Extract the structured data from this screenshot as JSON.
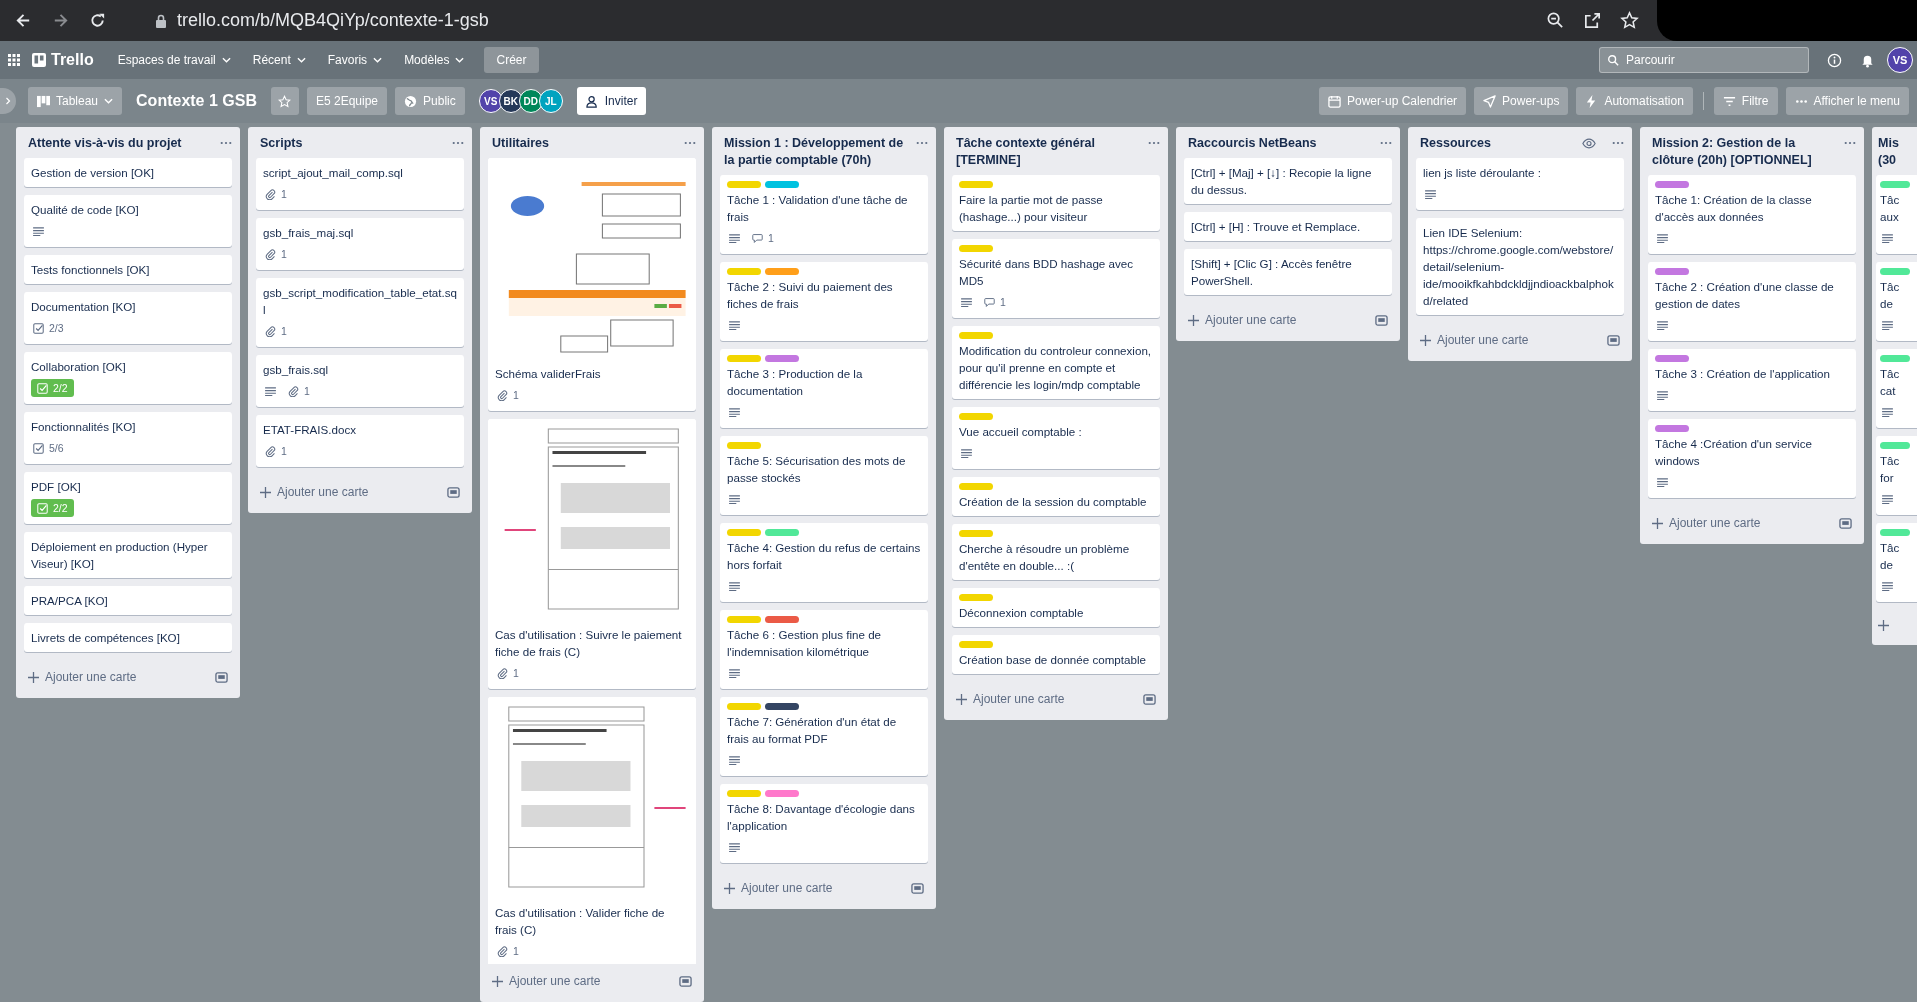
{
  "browser": {
    "url": "trello.com/b/MQB4QiYp/contexte-1-gsb"
  },
  "nav": {
    "logo": "Trello",
    "menus": [
      "Espaces de travail",
      "Récent",
      "Favoris",
      "Modèles"
    ],
    "create": "Créer",
    "search": {
      "placeholder": "Parcourir"
    },
    "avatar": {
      "initials": "VS",
      "color": "#5243aa"
    }
  },
  "board_header": {
    "view": "Tableau",
    "title": "Contexte 1 GSB",
    "starred": false,
    "workspace": "E5 2Equipe",
    "visibility": "Public",
    "members": [
      {
        "initials": "VS",
        "color": "#5243aa"
      },
      {
        "initials": "BK",
        "color": "#253858"
      },
      {
        "initials": "DD",
        "color": "#00875a"
      },
      {
        "initials": "JL",
        "color": "#00a3bf"
      }
    ],
    "invite": "Inviter",
    "actions": [
      {
        "kind": "calendar",
        "label": "Power-up Calendrier"
      },
      {
        "kind": "power-ups",
        "label": "Power-ups"
      },
      {
        "kind": "automation",
        "label": "Automatisation"
      },
      {
        "kind": "filter",
        "label": "Filtre"
      },
      {
        "kind": "menu",
        "label": "Afficher le menu"
      }
    ]
  },
  "lists": [
    {
      "title": "Attente vis-à-vis du projet",
      "watched": false,
      "cut_off": false,
      "add_label": "Ajouter une carte",
      "cards": [
        {
          "title": "Gestion de version [OK]"
        },
        {
          "title": "Qualité de code [KO]",
          "badges": [
            {
              "kind": "description"
            }
          ]
        },
        {
          "title": "Tests fonctionnels [OK]"
        },
        {
          "title": "Documentation [KO]",
          "badges": [
            {
              "kind": "checklist",
              "count": "2/3",
              "complete": false
            }
          ]
        },
        {
          "title": "Collaboration [OK]",
          "badges": [
            {
              "kind": "checklist",
              "count": "2/2",
              "complete": true
            }
          ]
        },
        {
          "title": "Fonctionnalités [KO]",
          "badges": [
            {
              "kind": "checklist",
              "count": "5/6",
              "complete": false
            }
          ]
        },
        {
          "title": "PDF [OK]",
          "badges": [
            {
              "kind": "checklist",
              "count": "2/2",
              "complete": true
            }
          ]
        },
        {
          "title": "Déploiement en production (Hyper Viseur) [KO]"
        },
        {
          "title": "PRA/PCA [KO]"
        },
        {
          "title": "Livrets de compétences [KO]"
        }
      ]
    },
    {
      "title": "Scripts",
      "watched": false,
      "cut_off": false,
      "add_label": "Ajouter une carte",
      "cards": [
        {
          "title": "script_ajout_mail_comp.sql",
          "badges": [
            {
              "kind": "attachments",
              "count": "1"
            }
          ]
        },
        {
          "title": "gsb_frais_maj.sql",
          "badges": [
            {
              "kind": "attachments",
              "count": "1"
            }
          ]
        },
        {
          "title": "gsb_script_modification_table_etat.sql",
          "badges": [
            {
              "kind": "attachments",
              "count": "1"
            }
          ]
        },
        {
          "title": "gsb_frais.sql",
          "badges": [
            {
              "kind": "description"
            },
            {
              "kind": "attachments",
              "count": "1"
            }
          ]
        },
        {
          "title": "ETAT-FRAIS.docx",
          "badges": [
            {
              "kind": "attachments",
              "count": "1"
            }
          ]
        }
      ]
    },
    {
      "title": "Utilitaires",
      "watched": false,
      "cut_off": false,
      "add_label": "Ajouter une carte",
      "cards": [
        {
          "cover": {
            "kind": "picture"
          },
          "title": "Schéma validerFrais",
          "badges": [
            {
              "kind": "attachments",
              "count": "1"
            }
          ]
        },
        {
          "cover": {
            "kind": "picture"
          },
          "title": "Cas d'utilisation : Suivre le paiement fiche de frais (C)",
          "badges": [
            {
              "kind": "attachments",
              "count": "1"
            }
          ]
        },
        {
          "cover": {
            "kind": "picture"
          },
          "title": "Cas d'utilisation : Valider fiche de frais (C)",
          "badges": [
            {
              "kind": "attachments",
              "count": "1"
            }
          ]
        }
      ]
    },
    {
      "title": "Mission 1 : Développement de la partie comptable (70h)",
      "watched": false,
      "cut_off": false,
      "add_label": "Ajouter une carte",
      "cards": [
        {
          "labels": [
            {
              "color": "#f2d600"
            },
            {
              "color": "#00c2e0"
            }
          ],
          "title": "Tâche 1 : Validation d'une tâche de frais",
          "badges": [
            {
              "kind": "description"
            },
            {
              "kind": "comments",
              "count": "1"
            }
          ]
        },
        {
          "labels": [
            {
              "color": "#f2d600"
            },
            {
              "color": "#ff9f1a"
            }
          ],
          "title": "Tâche 2 : Suivi du paiement des fiches de frais",
          "badges": [
            {
              "kind": "description"
            }
          ]
        },
        {
          "labels": [
            {
              "color": "#f2d600"
            },
            {
              "color": "#c377e0"
            }
          ],
          "title": "Tâche 3 : Production de la documentation",
          "badges": [
            {
              "kind": "description"
            }
          ]
        },
        {
          "labels": [
            {
              "color": "#f2d600"
            }
          ],
          "title": "Tâche 5: Sécurisation des mots de passe stockés",
          "badges": [
            {
              "kind": "description"
            }
          ]
        },
        {
          "labels": [
            {
              "color": "#f2d600"
            },
            {
              "color": "#51e898"
            }
          ],
          "title": "Tâche 4: Gestion du refus de certains hors forfait",
          "badges": [
            {
              "kind": "description"
            }
          ]
        },
        {
          "labels": [
            {
              "color": "#f2d600"
            },
            {
              "color": "#eb5a46"
            }
          ],
          "title": "Tâche 6 : Gestion plus fine de l'indemnisation kilométrique",
          "badges": [
            {
              "kind": "description"
            }
          ]
        },
        {
          "labels": [
            {
              "color": "#f2d600"
            },
            {
              "color": "#344563"
            }
          ],
          "title": "Tâche 7: Génération d'un état de frais au format PDF",
          "badges": [
            {
              "kind": "description"
            }
          ]
        },
        {
          "labels": [
            {
              "color": "#f2d600"
            },
            {
              "color": "#ff78cb"
            }
          ],
          "title": "Tâche 8: Davantage d'écologie dans l'application",
          "badges": [
            {
              "kind": "description"
            }
          ]
        }
      ]
    },
    {
      "title": "Tâche contexte général [TERMINE]",
      "watched": false,
      "cut_off": false,
      "add_label": "Ajouter une carte",
      "cards": [
        {
          "labels": [
            {
              "color": "#f2d600"
            }
          ],
          "title": "Faire la partie mot de passe (hashage...) pour visiteur"
        },
        {
          "labels": [
            {
              "color": "#f2d600"
            }
          ],
          "title": "Sécurité dans BDD hashage avec MD5",
          "badges": [
            {
              "kind": "description"
            },
            {
              "kind": "comments",
              "count": "1"
            }
          ]
        },
        {
          "labels": [
            {
              "color": "#f2d600"
            }
          ],
          "title": "Modification du controleur connexion, pour qu'il prenne en compte et différencie les login/mdp comptable"
        },
        {
          "labels": [
            {
              "color": "#f2d600"
            }
          ],
          "title": "Vue accueil comptable :",
          "badges": [
            {
              "kind": "description"
            }
          ]
        },
        {
          "labels": [
            {
              "color": "#f2d600"
            }
          ],
          "title": "Création de la session du comptable"
        },
        {
          "labels": [
            {
              "color": "#f2d600"
            }
          ],
          "title": "Cherche à résoudre un problème d'entête en double... :("
        },
        {
          "labels": [
            {
              "color": "#f2d600"
            }
          ],
          "title": "Déconnexion comptable"
        },
        {
          "labels": [
            {
              "color": "#f2d600"
            }
          ],
          "title": "Création base de donnée comptable"
        }
      ]
    },
    {
      "title": "Raccourcis NetBeans",
      "watched": false,
      "cut_off": false,
      "add_label": "Ajouter une carte",
      "cards": [
        {
          "title": "[Ctrl] + [Maj] + [↓] : Recopie la ligne du dessus."
        },
        {
          "title": "[Ctrl] + [H] : Trouve et Remplace."
        },
        {
          "title": "[Shift] + [Clic G] : Accès fenêtre PowerShell."
        }
      ]
    },
    {
      "title": "Ressources",
      "watched": true,
      "cut_off": false,
      "add_label": "Ajouter une carte",
      "cards": [
        {
          "title": "lien js liste déroulante :",
          "badges": [
            {
              "kind": "description"
            }
          ]
        },
        {
          "title": "Lien IDE Selenium: https://chrome.google.com/webstore/detail/selenium-ide/mooikfkahbdckldjjndioackbalphokd/related"
        }
      ]
    },
    {
      "title": "Mission 2: Gestion de la clôture (20h) [OPTIONNEL]",
      "watched": false,
      "cut_off": false,
      "add_label": "Ajouter une carte",
      "cards": [
        {
          "labels": [
            {
              "color": "#c377e0"
            }
          ],
          "title": "Tâche 1: Création de la classe d'accès aux données",
          "badges": [
            {
              "kind": "description"
            }
          ]
        },
        {
          "labels": [
            {
              "color": "#c377e0"
            }
          ],
          "title": "Tâche 2 : Création d'une classe de gestion de dates",
          "badges": [
            {
              "kind": "description"
            }
          ]
        },
        {
          "labels": [
            {
              "color": "#c377e0"
            }
          ],
          "title": "Tâche 3 : Création de l'application",
          "badges": [
            {
              "kind": "description"
            }
          ]
        },
        {
          "labels": [
            {
              "color": "#c377e0"
            }
          ],
          "title": "Tâche 4 :Création d'un service windows",
          "badges": [
            {
              "kind": "description"
            }
          ]
        }
      ]
    },
    {
      "title": "Mis (30",
      "watched": false,
      "cut_off": true,
      "cards": [
        {
          "labels": [
            {
              "color": "#51e898"
            }
          ],
          "title": "Tâc aux",
          "badges": [
            {
              "kind": "description"
            }
          ]
        },
        {
          "labels": [
            {
              "color": "#51e898"
            }
          ],
          "title": "Tâc de",
          "badges": [
            {
              "kind": "description"
            }
          ]
        },
        {
          "labels": [
            {
              "color": "#51e898"
            }
          ],
          "title": "Tâc cat",
          "badges": [
            {
              "kind": "description"
            }
          ]
        },
        {
          "labels": [
            {
              "color": "#51e898"
            }
          ],
          "title": "Tâc for",
          "badges": [
            {
              "kind": "description"
            }
          ]
        },
        {
          "labels": [
            {
              "color": "#51e898"
            }
          ],
          "title": "Tâc de",
          "badges": [
            {
              "kind": "description"
            }
          ]
        }
      ]
    }
  ]
}
